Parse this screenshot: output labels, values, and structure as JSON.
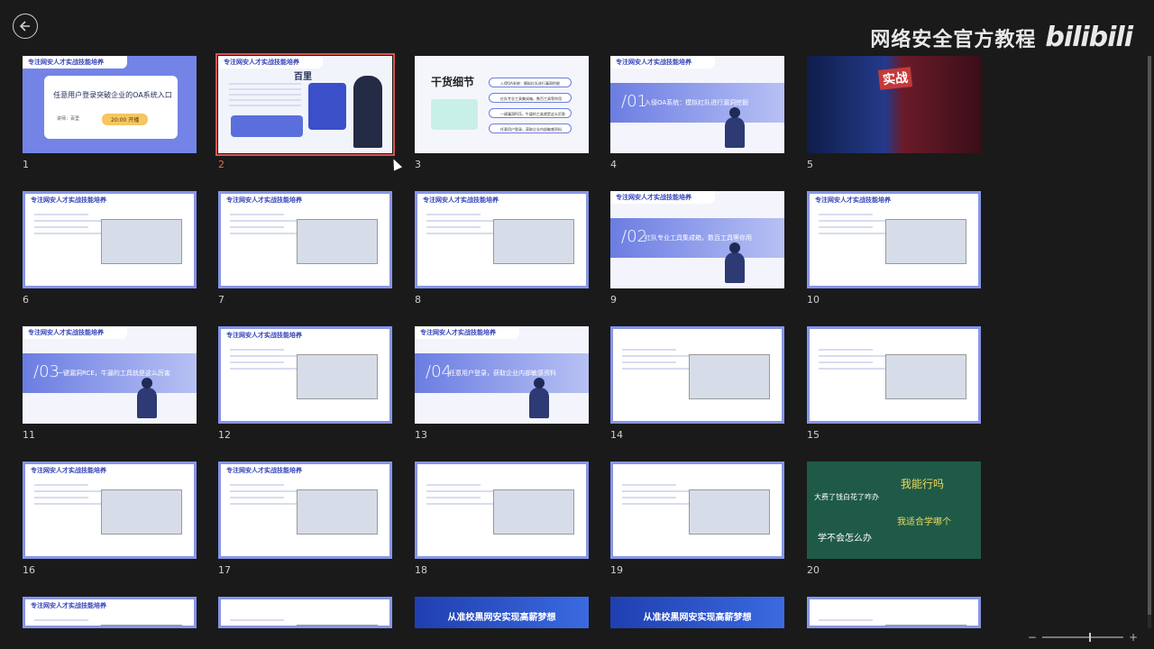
{
  "watermark": {
    "text": "网络安全官方教程",
    "logo": "bilibili"
  },
  "back_icon": "arrow-left-circle-icon",
  "zoom": {
    "minus": "−",
    "plus": "+"
  },
  "slides": [
    {
      "n": "1",
      "type": "title",
      "head": "专注网安人才实战技能培养",
      "title": "任意用户登录突破企业的OA系统入口",
      "speaker": "讲师：百里",
      "time": "20:00 开播"
    },
    {
      "n": "2",
      "type": "profile",
      "head": "专注网安人才实战技能培养",
      "name": "百里",
      "selected": true
    },
    {
      "n": "3",
      "type": "agenda",
      "title": "干货细节",
      "items": [
        "入侵OA系统：模拟红队进行漏洞挖掘",
        "红队专业工具集成箱，数百工具等你用",
        "一键漏洞RCE，牛逼的工具就是这么厉害",
        "任意用户登录，获取企业内部敏感资料"
      ]
    },
    {
      "n": "4",
      "type": "section",
      "head": "专注网安人才实战技能培养",
      "num": "/01",
      "text": "入侵OA系统：模拟红队进行漏洞挖掘"
    },
    {
      "n": "5",
      "type": "image",
      "badge": "实战"
    },
    {
      "n": "6",
      "type": "content",
      "head": "专注网安人才实战技能培养"
    },
    {
      "n": "7",
      "type": "content",
      "head": "专注网安人才实战技能培养"
    },
    {
      "n": "8",
      "type": "content",
      "head": "专注网安人才实战技能培养"
    },
    {
      "n": "9",
      "type": "section",
      "head": "专注网安人才实战技能培养",
      "num": "/02",
      "text": "红队专业工具集成箱，数百工具等你用"
    },
    {
      "n": "10",
      "type": "content",
      "head": "专注网安人才实战技能培养"
    },
    {
      "n": "11",
      "type": "section",
      "head": "专注网安人才实战技能培养",
      "num": "/03",
      "text": "一键漏洞RCE，牛逼的工具就是这么厉害"
    },
    {
      "n": "12",
      "type": "content",
      "head": "专注网安人才实战技能培养"
    },
    {
      "n": "13",
      "type": "section",
      "head": "专注网安人才实战技能培养",
      "num": "/04",
      "text": "任意用户登录，获取企业内部敏感资料"
    },
    {
      "n": "14",
      "type": "content",
      "head": ""
    },
    {
      "n": "15",
      "type": "content",
      "head": ""
    },
    {
      "n": "16",
      "type": "content",
      "head": "专注网安人才实战技能培养"
    },
    {
      "n": "17",
      "type": "content",
      "head": "专注网安人才实战技能培养"
    },
    {
      "n": "18",
      "type": "content",
      "head": ""
    },
    {
      "n": "19",
      "type": "content",
      "head": ""
    },
    {
      "n": "20",
      "type": "board",
      "lines": [
        "我能行吗",
        "大费了钱白花了咋办",
        "我适合学哪个",
        "学不会怎么办"
      ]
    },
    {
      "n": "",
      "type": "content",
      "head": "专注网安人才实战技能培养"
    },
    {
      "n": "",
      "type": "content",
      "head": ""
    },
    {
      "n": "",
      "type": "banner",
      "text": "从准校黑网安实现高薪梦想"
    },
    {
      "n": "",
      "type": "banner",
      "text": "从准校黑网安实现高薪梦想"
    },
    {
      "n": "",
      "type": "content",
      "head": ""
    }
  ]
}
